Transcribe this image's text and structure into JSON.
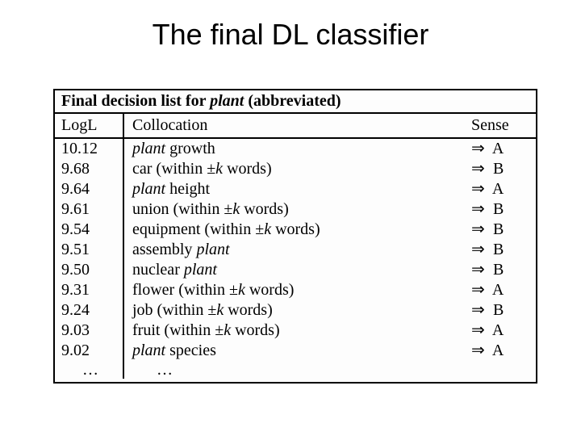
{
  "title": "The final DL classifier",
  "table": {
    "caption_prefix": "Final decision list for ",
    "caption_word": "plant",
    "caption_suffix": " (abbreviated)",
    "headers": {
      "logl": "LogL",
      "colloc": "Collocation",
      "sense": "Sense"
    },
    "arrow": "⇒",
    "rows": [
      {
        "logl": "10.12",
        "colloc_html": "<span class='ital'>plant</span> growth",
        "sense": "A"
      },
      {
        "logl": "9.68",
        "colloc_html": "car (within ±<span class='ital'>k</span> words)",
        "sense": "B"
      },
      {
        "logl": "9.64",
        "colloc_html": "<span class='ital'>plant</span> height",
        "sense": "A"
      },
      {
        "logl": "9.61",
        "colloc_html": "union (within ±<span class='ital'>k</span> words)",
        "sense": "B"
      },
      {
        "logl": "9.54",
        "colloc_html": "equipment (within ±<span class='ital'>k</span> words)",
        "sense": "B"
      },
      {
        "logl": "9.51",
        "colloc_html": "assembly <span class='ital'>plant</span>",
        "sense": "B"
      },
      {
        "logl": "9.50",
        "colloc_html": "nuclear <span class='ital'>plant</span>",
        "sense": "B"
      },
      {
        "logl": "9.31",
        "colloc_html": "flower (within ±<span class='ital'>k</span> words)",
        "sense": "A"
      },
      {
        "logl": "9.24",
        "colloc_html": "job (within ±<span class='ital'>k</span> words)",
        "sense": "B"
      },
      {
        "logl": "9.03",
        "colloc_html": "fruit (within ±<span class='ital'>k</span> words)",
        "sense": "A"
      },
      {
        "logl": "9.02",
        "colloc_html": "<span class='ital'>plant</span> species",
        "sense": "A"
      }
    ],
    "ellipsis": "…"
  },
  "chart_data": {
    "type": "table",
    "title": "Final decision list for plant (abbreviated)",
    "columns": [
      "LogL",
      "Collocation",
      "Sense"
    ],
    "rows": [
      [
        10.12,
        "plant growth",
        "A"
      ],
      [
        9.68,
        "car (within ±k words)",
        "B"
      ],
      [
        9.64,
        "plant height",
        "A"
      ],
      [
        9.61,
        "union (within ±k words)",
        "B"
      ],
      [
        9.54,
        "equipment (within ±k words)",
        "B"
      ],
      [
        9.51,
        "assembly plant",
        "B"
      ],
      [
        9.5,
        "nuclear plant",
        "B"
      ],
      [
        9.31,
        "flower (within ±k words)",
        "A"
      ],
      [
        9.24,
        "job (within ±k words)",
        "B"
      ],
      [
        9.03,
        "fruit (within ±k words)",
        "A"
      ],
      [
        9.02,
        "plant species",
        "A"
      ]
    ]
  }
}
